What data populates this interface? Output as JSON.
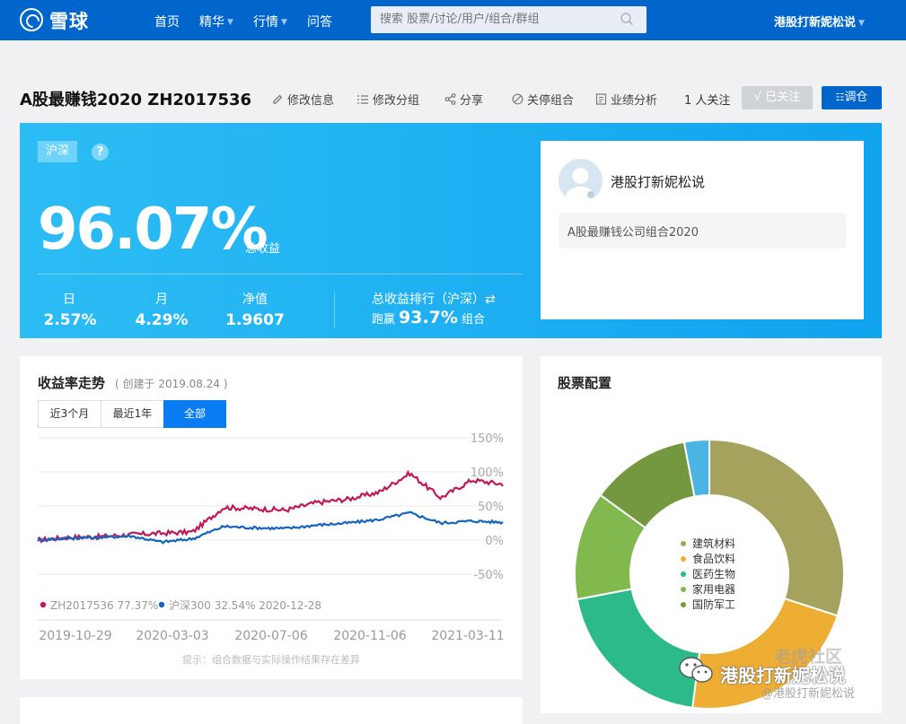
{
  "nav": {
    "logo_text": "雪球",
    "items": [
      {
        "label": "首页",
        "has_caret": false
      },
      {
        "label": "精华",
        "has_caret": true
      },
      {
        "label": "行情",
        "has_caret": true
      },
      {
        "label": "问答",
        "has_caret": false
      }
    ],
    "search_placeholder": "搜索 股票/讨论/用户/组合/群组",
    "user_name": "港股打新妮松说"
  },
  "header": {
    "title": "A股最赚钱2020 ZH2017536",
    "actions": [
      "修改信息",
      "修改分组",
      "分享",
      "关停组合",
      "业绩分析"
    ],
    "followers": "1 人关注",
    "followed_label": "√ 已关注",
    "rebalance_label": "调仓"
  },
  "hero": {
    "market_tag": "沪深",
    "help": "?",
    "total_return": "96.07%",
    "total_return_label": "总收益",
    "stats": [
      {
        "label": "日",
        "value": "2.57%"
      },
      {
        "label": "月",
        "value": "4.29%"
      },
      {
        "label": "净值",
        "value": "1.9607"
      }
    ],
    "rank_label": "总收益排行（沪深）⇄",
    "rank_prefix": "跑赢",
    "rank_value": "93.7%",
    "rank_suffix": "组合",
    "owner_name": "港股打新妮松说",
    "portfolio_desc": "A股最赚钱公司组合2020"
  },
  "return_chart": {
    "title": "收益率走势",
    "created": "( 创建于 2019.08.24 )",
    "ranges": [
      "近3个月",
      "最近1年",
      "全部"
    ],
    "active_range": 2,
    "hint": "提示：组合数据与实际操作结果存在差异"
  },
  "chart_data": [
    {
      "type": "line",
      "x": [
        "2019-10-29",
        "2019-12-10",
        "2020-01-21",
        "2020-03-03",
        "2020-04-14",
        "2020-05-26",
        "2020-07-06",
        "2020-08-17",
        "2020-09-28",
        "2020-11-06",
        "2020-12-08",
        "2020-12-28",
        "2021-01-19",
        "2021-02-09",
        "2021-03-11",
        "2021-04-01"
      ],
      "x_ticks": [
        "2019-10-29",
        "2020-03-03",
        "2020-07-06",
        "2020-11-06",
        "2021-03-11"
      ],
      "y_ticks": [
        "150%",
        "100%",
        "50%",
        "0%",
        "-50%"
      ],
      "ylim": [
        -50,
        150
      ],
      "grid": true,
      "legend_position": "bottom-left",
      "series": [
        {
          "name": "ZH2017536",
          "legend_value": "77.37%",
          "color": "#c2185b",
          "values": [
            0,
            4,
            5,
            8,
            10,
            12,
            48,
            46,
            44,
            55,
            60,
            70,
            98,
            62,
            88,
            82
          ]
        },
        {
          "name": "沪深300",
          "legend_value": "32.54%",
          "legend_date": "2020-12-28",
          "color": "#1565c0",
          "values": [
            0,
            3,
            4,
            6,
            -3,
            2,
            20,
            18,
            17,
            22,
            25,
            30,
            40,
            25,
            28,
            26
          ]
        }
      ]
    },
    {
      "type": "pie",
      "title": "股票配置",
      "donut": true,
      "slices": [
        {
          "label": "建筑材料",
          "value": 30,
          "color": "#a5a25e"
        },
        {
          "label": "食品饮料",
          "value": 22,
          "color": "#eeae33"
        },
        {
          "label": "医药生物",
          "value": 20,
          "color": "#2dba8a"
        },
        {
          "label": "家用电器",
          "value": 13,
          "color": "#82b94f"
        },
        {
          "label": "国防军工",
          "value": 12,
          "color": "#74983f"
        },
        {
          "label": "",
          "value": 3,
          "color": "#4ab5e2"
        }
      ]
    }
  ],
  "watermark": {
    "line1": "老虎社区",
    "line2": "港股打新妮松说",
    "line3": "@港股打新妮松说"
  }
}
